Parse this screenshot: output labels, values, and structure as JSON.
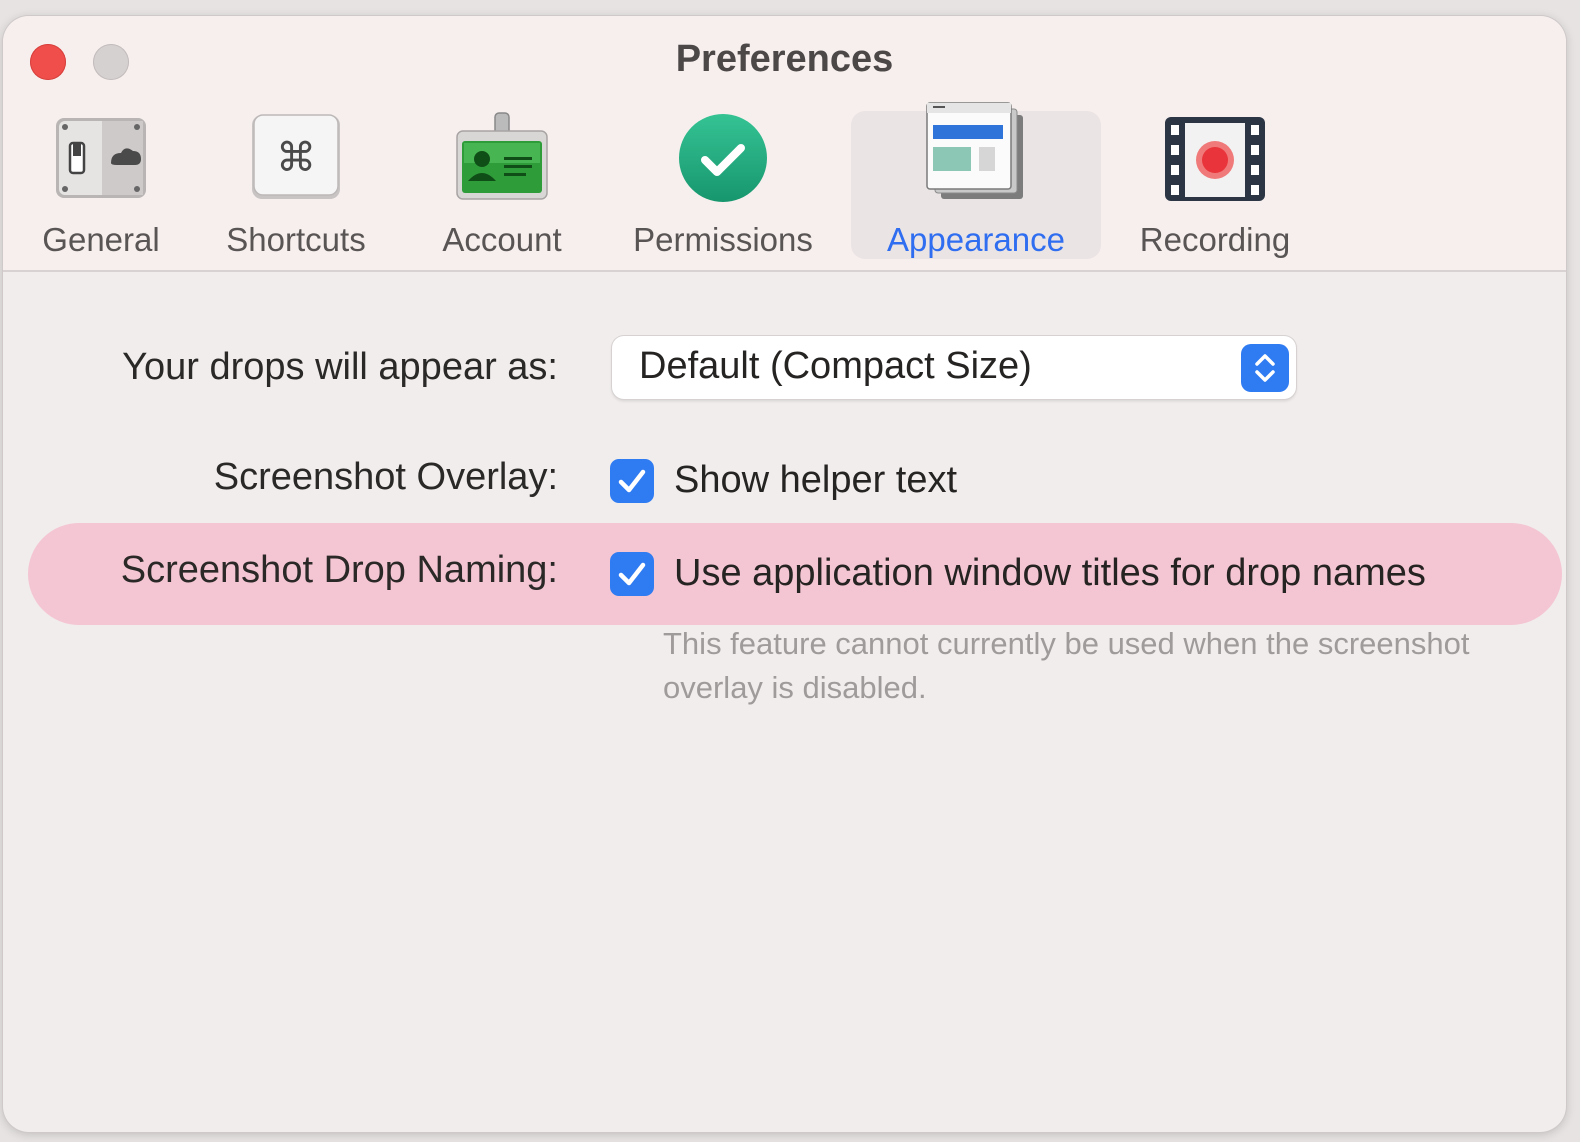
{
  "window": {
    "title": "Preferences"
  },
  "tabs": [
    {
      "label": "General",
      "icon": "general-switch-icon",
      "selected": false
    },
    {
      "label": "Shortcuts",
      "icon": "command-key-icon",
      "selected": false
    },
    {
      "label": "Account",
      "icon": "id-badge-icon",
      "selected": false
    },
    {
      "label": "Permissions",
      "icon": "checkmark-circle-icon",
      "selected": false
    },
    {
      "label": "Appearance",
      "icon": "window-layout-icon",
      "selected": true
    },
    {
      "label": "Recording",
      "icon": "film-record-icon",
      "selected": false
    }
  ],
  "settings": {
    "appearance": {
      "label": "Your drops will appear as:",
      "value": "Default (Compact Size)"
    },
    "overlay": {
      "label": "Screenshot Overlay:",
      "checkbox_label": "Show helper text",
      "checked": true
    },
    "naming": {
      "label": "Screenshot Drop Naming:",
      "checkbox_label": "Use application window titles for drop names",
      "checked": true,
      "note": "This feature cannot currently be used when the screenshot overlay is disabled."
    }
  },
  "colors": {
    "accent": "#2f7bf2",
    "highlight": "#f5a5be",
    "close": "#ef4e4b"
  }
}
